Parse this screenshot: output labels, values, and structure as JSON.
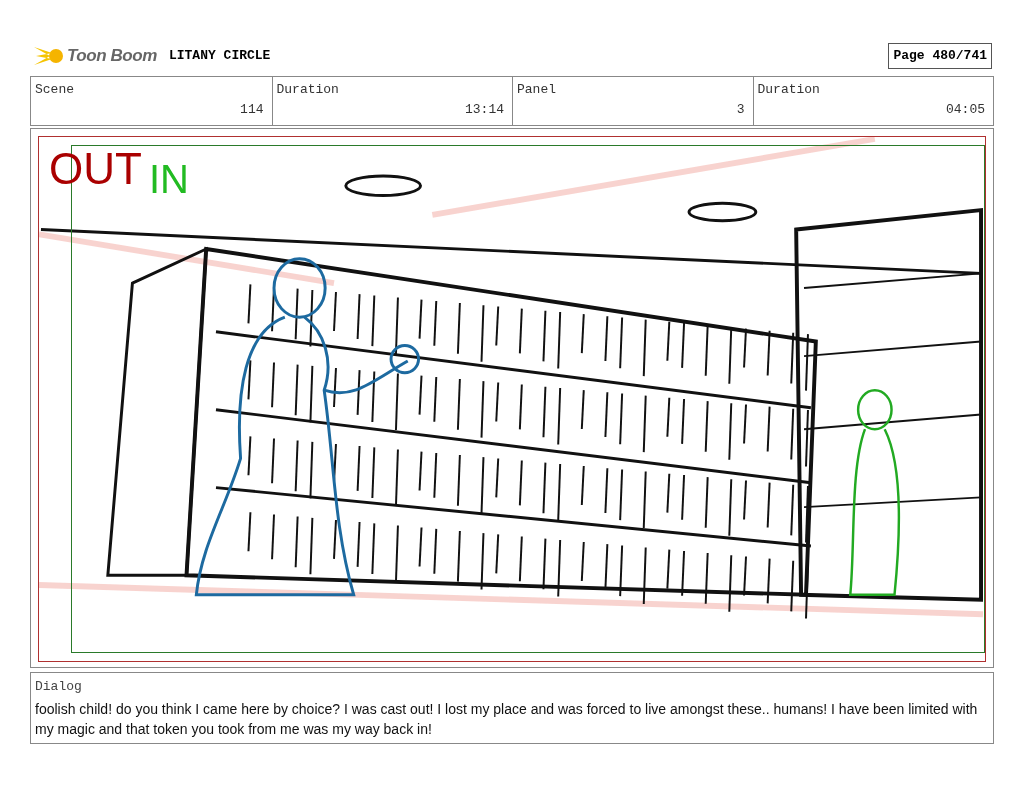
{
  "header": {
    "logo_text": "Toon Boom",
    "project_title": "LITANY CIRCLE",
    "page": "Page 480/741"
  },
  "fields": [
    {
      "label": "Scene",
      "value": "114"
    },
    {
      "label": "Duration",
      "value": "13:14"
    },
    {
      "label": "Panel",
      "value": "3"
    },
    {
      "label": "Duration",
      "value": "04:05"
    }
  ],
  "panel": {
    "out_label": "OUT",
    "in_label": "IN"
  },
  "dialog": {
    "label": "Dialog",
    "text": "foolish child! do you think I came here by choice? I was cast out! I lost my place and was forced to live amongst these.. humans! I have been limited with my magic and that token you took from me was my way back in!"
  }
}
